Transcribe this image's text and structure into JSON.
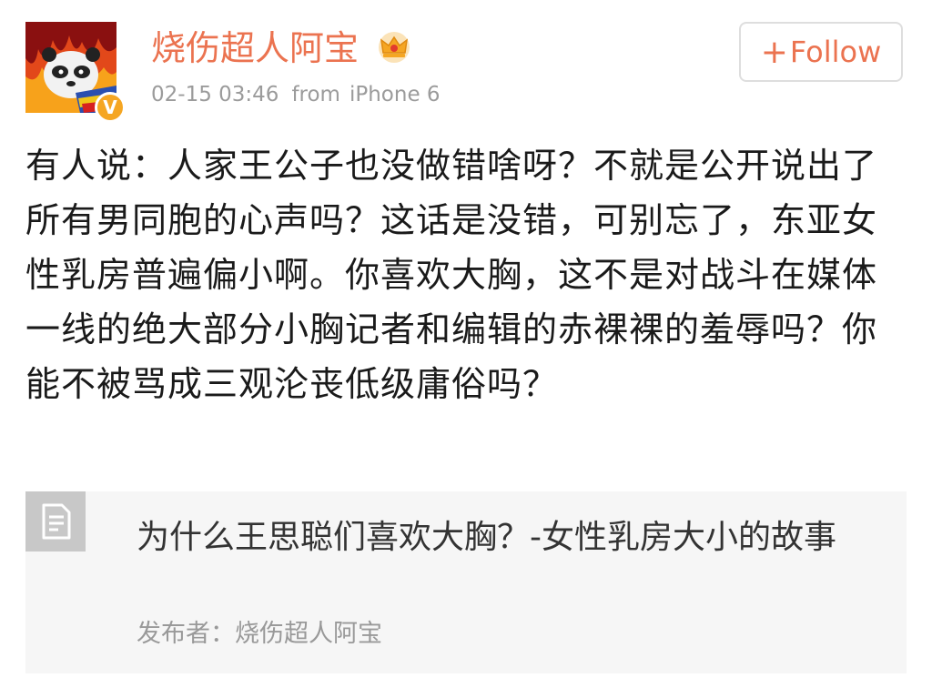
{
  "post": {
    "username": "烧伤超人阿宝",
    "timestamp": "02-15 03:46",
    "from_label": "from",
    "device": "iPhone 6",
    "follow_label": "Follow",
    "follow_icon": "plus-icon",
    "verified_badge": "V",
    "crown_icon": "crown-icon",
    "text": "有人说：人家王公子也没做错啥呀？不就是公开说出了所有男同胞的心声吗？这话是没错，可别忘了，东亚女性乳房普遍偏小啊。你喜欢大胸，这不是对战斗在媒体一线的绝大部分小胸记者和编辑的赤裸裸的羞辱吗？你能不被骂成三观沦丧低级庸俗吗？"
  },
  "linked_article": {
    "icon": "document-icon",
    "title": "为什么王思聪们喜欢大胸？-女性乳房大小的故事",
    "author": "发布者：烧伤超人阿宝"
  },
  "colors": {
    "accent": "#eb7350",
    "meta_gray": "#9b9b9b",
    "badge_orange": "#f5a623",
    "card_bg": "#f6f6f6"
  }
}
